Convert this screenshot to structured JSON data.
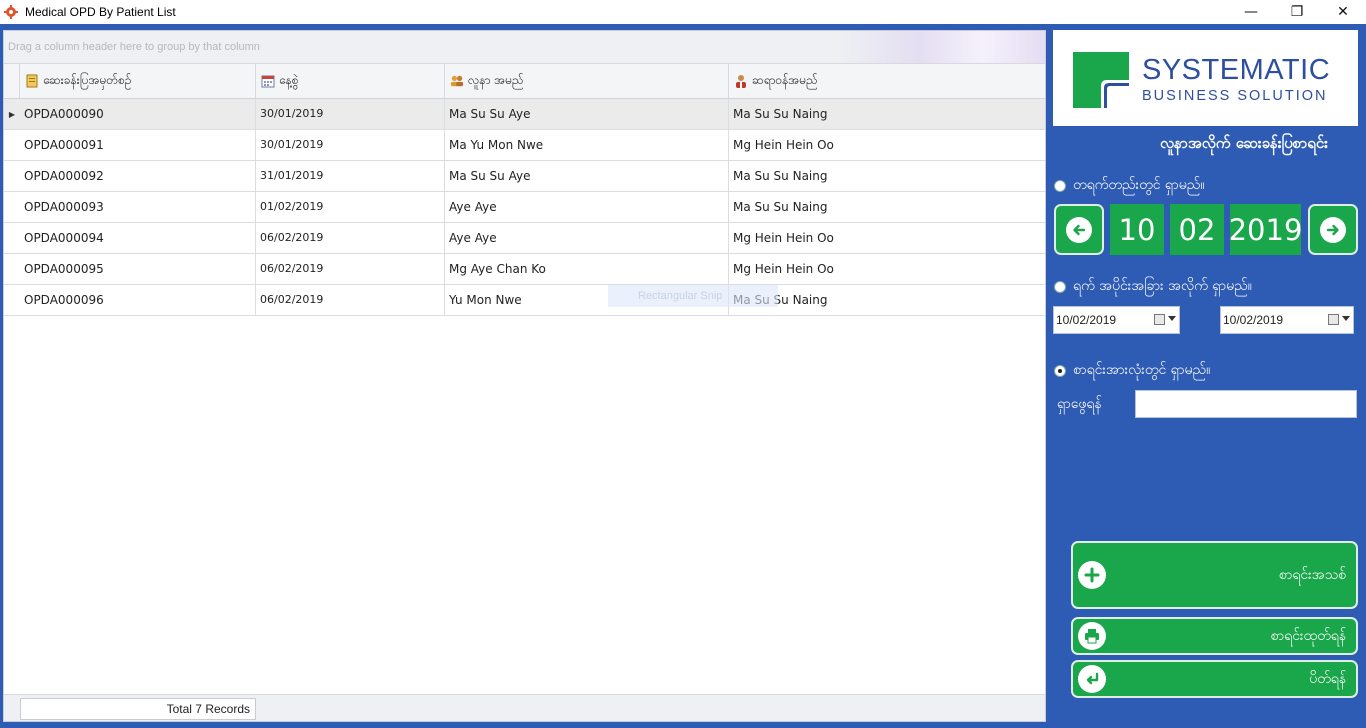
{
  "window": {
    "title": "Medical OPD By Patient List",
    "controls": {
      "minimize": "—",
      "maximize": "❐",
      "close": "✕"
    }
  },
  "grid": {
    "group_hint": "Drag a column header here to group by that column",
    "columns": [
      {
        "label": "ဆေးခန်းပြအမှတ်စဉ်",
        "icon": "document-icon"
      },
      {
        "label": "နေ့စွဲ",
        "icon": "calendar-icon"
      },
      {
        "label": "လူနာ အမည်",
        "icon": "patients-icon"
      },
      {
        "label": "ဆရာဝန်အမည်",
        "icon": "doctor-icon"
      }
    ],
    "rows": [
      [
        "OPDA000090",
        "30/01/2019",
        "Ma Su Su Aye",
        "Ma Su Su Naing"
      ],
      [
        "OPDA000091",
        "30/01/2019",
        "Ma Yu Mon Nwe",
        "Mg Hein Hein Oo"
      ],
      [
        "OPDA000092",
        "31/01/2019",
        "Ma Su Su Aye",
        "Ma Su Su Naing"
      ],
      [
        "OPDA000093",
        "01/02/2019",
        "Aye Aye",
        "Ma Su Su Naing"
      ],
      [
        "OPDA000094",
        "06/02/2019",
        "Aye Aye",
        "Mg Hein Hein Oo"
      ],
      [
        "OPDA000095",
        "06/02/2019",
        "Mg Aye Chan Ko",
        "Mg Hein Hein Oo"
      ],
      [
        "OPDA000096",
        "06/02/2019",
        "Yu Mon Nwe",
        "Ma Su Su Naing"
      ]
    ],
    "selected_row": 0,
    "footer_total": "Total 7 Records",
    "ghost_tooltip": "Rectangular Snip"
  },
  "panel": {
    "logo_title": "SYSTEMATIC",
    "logo_subtitle": "BUSINESS SOLUTION",
    "heading": "လူနာအလိုက် ဆေးခန်းပြစာရင်း",
    "radio_single_day": "တရက်တည်းတွင် ရှာမည်။",
    "radio_range": "ရက် အပိုင်းအခြား အလိုက် ရှာမည်။",
    "radio_all": "စာရင်းအားလုံးတွင် ရှာမည်။",
    "selected_radio": "all",
    "day": "10",
    "month": "02",
    "year": "2019",
    "date_from": "10/02/2019",
    "date_to": "10/02/2019",
    "search_label": "ရှာဖွေရန်",
    "search_value": "",
    "btn_new": "စာရင်းအသစ်",
    "btn_print": "စာရင်းထုတ်ရန်",
    "btn_close": "ပိတ်ရန်"
  },
  "colors": {
    "window_bg": "#2e5bb3",
    "accent_green": "#1aa64a",
    "logo_blue": "#2e4f9f"
  }
}
